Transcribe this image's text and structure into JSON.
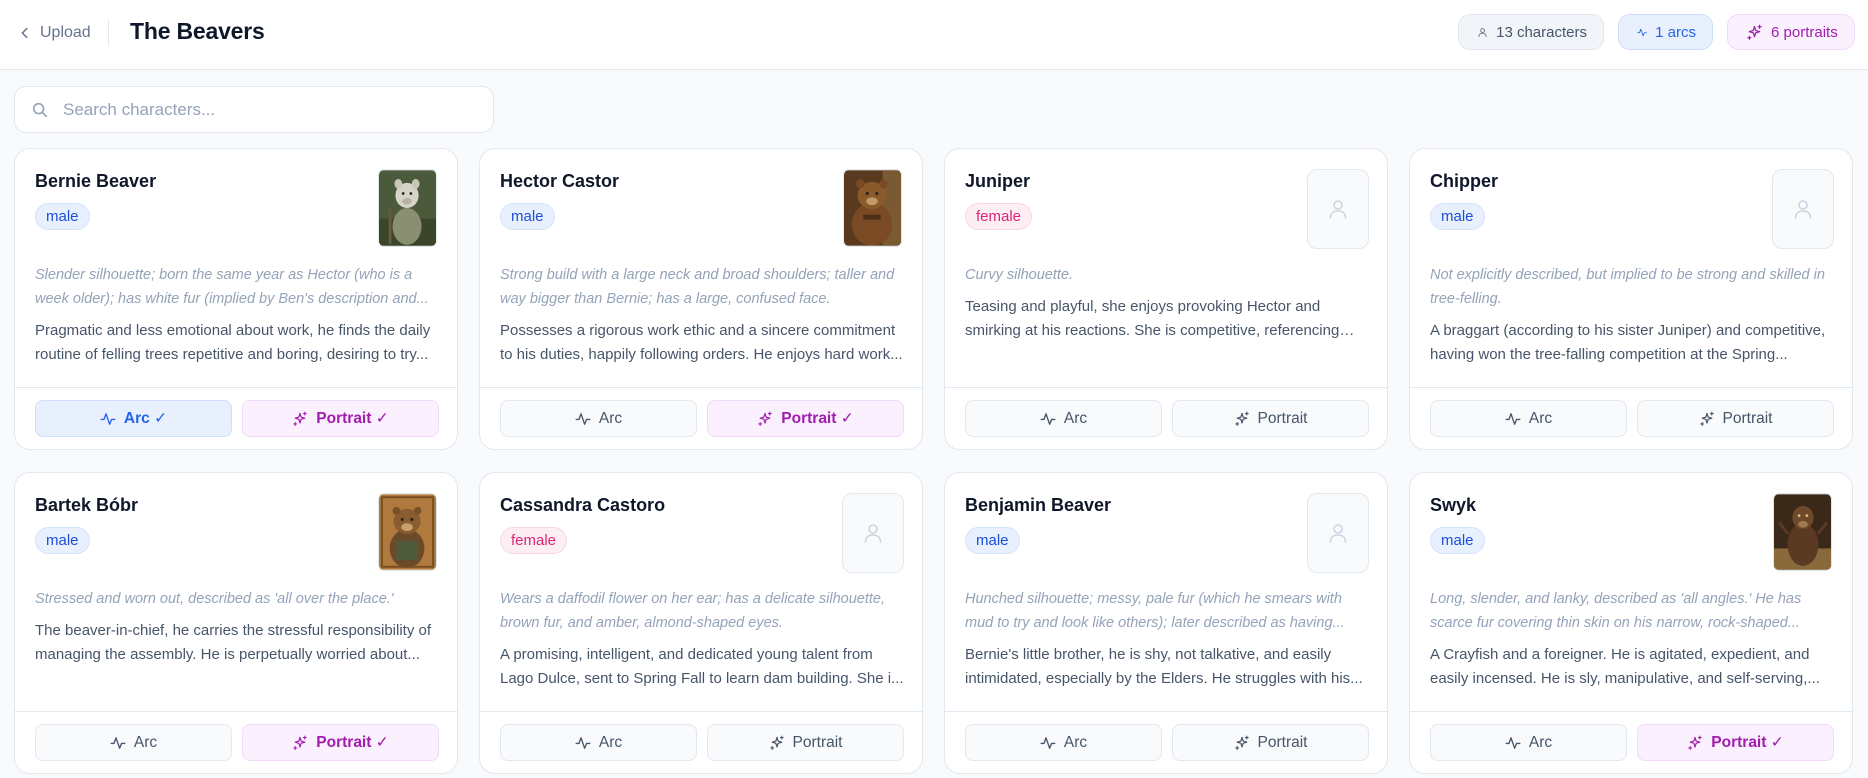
{
  "header": {
    "back_label": "Upload",
    "title": "The Beavers",
    "stats": {
      "characters": "13 characters",
      "arcs": "1 arcs",
      "portraits": "6 portraits"
    }
  },
  "search": {
    "placeholder": "Search characters..."
  },
  "colors": {
    "arc_accent": "#2563eb",
    "portrait_accent": "#a21caf",
    "male": "#1d4ed8",
    "female": "#db2777"
  },
  "cards": [
    {
      "name": "Bernie Beaver",
      "gender": "male",
      "appearance": "Slender silhouette; born the same year as Hector (who is a week older); has white fur (implied by Ben's description and...",
      "bio": "Pragmatic and less emotional about work, he finds the daily routine of felling trees repetitive and boring, desiring to try...",
      "arc_label": "Arc ✓",
      "portrait_label": "Portrait ✓"
    },
    {
      "name": "Hector Castor",
      "gender": "male",
      "appearance": "Strong build with a large neck and broad shoulders; taller and way bigger than Bernie; has a large, confused face.",
      "bio": "Possesses a rigorous work ethic and a sincere commitment to his duties, happily following orders. He enjoys hard work...",
      "arc_label": "Arc",
      "portrait_label": "Portrait ✓"
    },
    {
      "name": "Juniper",
      "gender": "female",
      "appearance": "Curvy silhouette.",
      "bio": "Teasing and playful, she enjoys provoking Hector and smirking at his reactions. She is competitive, referencing he...",
      "arc_label": "Arc",
      "portrait_label": "Portrait"
    },
    {
      "name": "Chipper",
      "gender": "male",
      "appearance": "Not explicitly described, but implied to be strong and skilled in tree-felling.",
      "bio": "A braggart (according to his sister Juniper) and competitive, having won the tree-falling competition at the Spring...",
      "arc_label": "Arc",
      "portrait_label": "Portrait"
    },
    {
      "name": "Bartek Bóbr",
      "gender": "male",
      "appearance": "Stressed and worn out, described as 'all over the place.'",
      "bio": "The beaver-in-chief, he carries the stressful responsibility of managing the assembly. He is perpetually worried about...",
      "arc_label": "Arc",
      "portrait_label": "Portrait ✓"
    },
    {
      "name": "Cassandra Castoro",
      "gender": "female",
      "appearance": "Wears a daffodil flower on her ear; has a delicate silhouette, brown fur, and amber, almond-shaped eyes.",
      "bio": "A promising, intelligent, and dedicated young talent from Lago Dulce, sent to Spring Fall to learn dam building. She i...",
      "arc_label": "Arc",
      "portrait_label": "Portrait"
    },
    {
      "name": "Benjamin Beaver",
      "gender": "male",
      "appearance": "Hunched silhouette; messy, pale fur (which he smears with mud to try and look like others); later described as having...",
      "bio": "Bernie's little brother, he is shy, not talkative, and easily intimidated, especially by the Elders. He struggles with his...",
      "arc_label": "Arc",
      "portrait_label": "Portrait"
    },
    {
      "name": "Swyk",
      "gender": "male",
      "appearance": "Long, slender, and lanky, described as 'all angles.' He has scarce fur covering thin skin on his narrow, rock-shaped...",
      "bio": "A Crayfish and a foreigner. He is agitated, expedient, and easily incensed. He is sly, manipulative, and self-serving,...",
      "arc_label": "Arc",
      "portrait_label": "Portrait ✓"
    }
  ]
}
